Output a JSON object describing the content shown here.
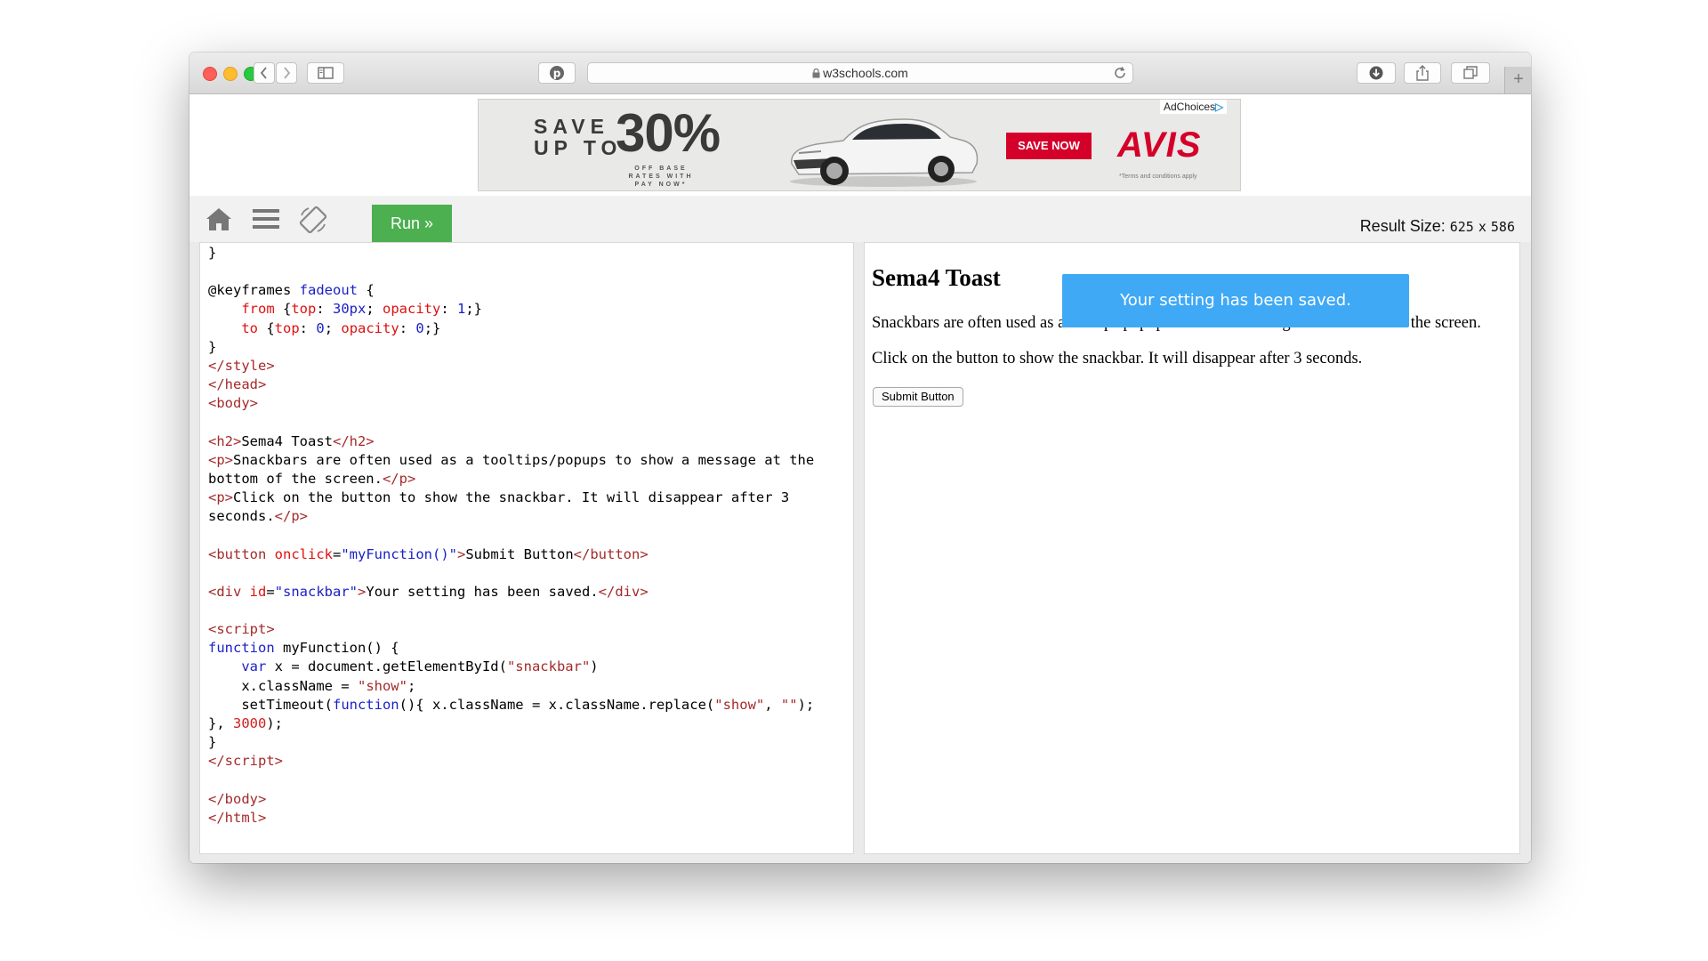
{
  "browser": {
    "url": "w3schools.com",
    "new_tab": "+"
  },
  "ad": {
    "save_up_to": "SAVE\nUP TO",
    "percent": "30%",
    "fine_print": "OFF BASE RATES WITH PAY NOW*",
    "cta": "SAVE NOW",
    "brand": "AVIS",
    "terms": "*Terms and conditions apply",
    "adchoices": "AdChoices"
  },
  "toolbar": {
    "run_label": "Run »",
    "result_size_label": "Result Size:",
    "result_width": "625",
    "result_x": "x",
    "result_height": "586"
  },
  "result": {
    "heading": "Sema4 Toast",
    "paragraph1": "Snackbars are often used as a tooltips/popups to show a message at the bottom of the screen.",
    "paragraph2": "Click on the button to show the snackbar. It will disappear after 3 seconds.",
    "button_label": "Submit Button",
    "snackbar_text": "Your setting has been saved."
  },
  "colors": {
    "run_button": "#4caf50",
    "snackbar": "#3fa9f5",
    "ad_red": "#d4002a"
  }
}
